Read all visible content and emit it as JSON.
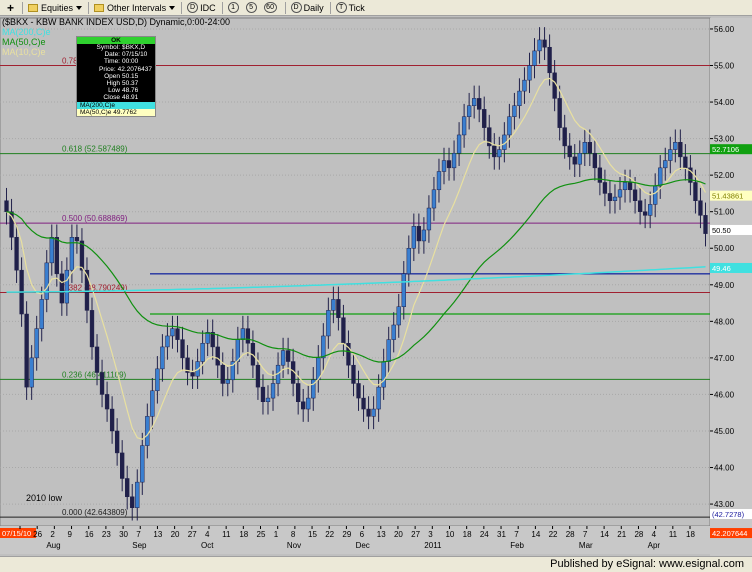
{
  "toolbar": {
    "symbol": "($BKX",
    "group": "Equities",
    "intervals": "Other Intervals",
    "buttons": [
      {
        "glyph": "D",
        "label": "IDC"
      },
      {
        "glyph": "1",
        "label": "1"
      },
      {
        "glyph": "5",
        "label": "5"
      },
      {
        "glyph": "60",
        "label": "60"
      },
      {
        "glyph": "D",
        "label": "Daily"
      },
      {
        "glyph": "T",
        "label": "Tick"
      }
    ]
  },
  "chart": {
    "title": "($BKX - KBW BANK INDEX USD,D) Dynamic,0:00-24:00",
    "legend": {
      "ma50": "MA(50,C)e",
      "ma10": "MA(10,C)e"
    },
    "low_note": "2010 low"
  },
  "data_window": {
    "header": "OK",
    "rows": [
      {
        "k": "Symbol:",
        "v": "$BKX,D"
      },
      {
        "k": "Date:",
        "v": "07/15/10"
      },
      {
        "k": "Time:",
        "v": "00:00"
      },
      {
        "k": "Price:",
        "v": "42.2076437"
      },
      {
        "k": "Open",
        "v": "50.15"
      },
      {
        "k": "High",
        "v": "50.37"
      },
      {
        "k": "Low",
        "v": "48.76"
      },
      {
        "k": "Close",
        "v": "48.91"
      }
    ],
    "ma1": "MA(200,C)e",
    "ma2": "MA(50,C)e 49.7762"
  },
  "chart_data": {
    "type": "candlestick",
    "title": "($BKX - KBW BANK INDEX USD,D) Dynamic,0:00-24:00",
    "ylim": [
      42.4,
      56.3
    ],
    "y_ticks": [
      "56.00",
      "55.00",
      "54.00",
      "53.00",
      "52.00",
      "51.00",
      "50.00",
      "49.00",
      "48.00",
      "47.00",
      "46.00",
      "45.00",
      "44.00",
      "43.00"
    ],
    "x_tick_labels": [
      "19",
      "26",
      "2",
      "9",
      "16",
      "23",
      "30",
      "7",
      "13",
      "20",
      "27",
      "4",
      "11",
      "18",
      "25",
      "1",
      "8",
      "15",
      "22",
      "29",
      "6",
      "13",
      "20",
      "27",
      "3",
      "10",
      "18",
      "24",
      "31",
      "7",
      "14",
      "22",
      "28",
      "7",
      "14",
      "21",
      "28",
      "4",
      "11",
      "18"
    ],
    "month_labels": [
      "Aug",
      "Sep",
      "Oct",
      "Nov",
      "Dec",
      "2011",
      "Feb",
      "Mar",
      "Apr"
    ],
    "start_date_label": "07/15/10",
    "close": [
      51.0,
      50.3,
      49.4,
      48.2,
      46.2,
      47.0,
      47.8,
      48.6,
      49.6,
      50.3,
      49.3,
      48.5,
      49.4,
      50.3,
      50.2,
      49.4,
      48.3,
      47.3,
      46.6,
      46.0,
      45.6,
      45.0,
      44.4,
      43.7,
      43.2,
      42.9,
      43.6,
      44.6,
      45.4,
      46.1,
      46.7,
      47.3,
      47.6,
      47.8,
      47.5,
      47.0,
      46.6,
      46.5,
      46.9,
      47.4,
      47.7,
      47.3,
      46.8,
      46.3,
      46.4,
      46.9,
      47.5,
      47.8,
      47.4,
      46.8,
      46.2,
      45.8,
      45.9,
      46.3,
      46.8,
      47.2,
      46.9,
      46.3,
      45.8,
      45.6,
      45.9,
      46.4,
      47.0,
      47.6,
      48.3,
      48.6,
      48.1,
      47.4,
      46.8,
      46.3,
      45.9,
      45.6,
      45.4,
      45.6,
      46.2,
      46.9,
      47.5,
      47.9,
      48.4,
      49.3,
      50.0,
      50.6,
      50.2,
      50.5,
      51.1,
      51.6,
      52.1,
      52.4,
      52.2,
      52.6,
      53.1,
      53.6,
      53.9,
      54.1,
      53.8,
      53.3,
      52.8,
      52.5,
      52.7,
      53.1,
      53.6,
      53.9,
      54.3,
      54.6,
      55.0,
      55.4,
      55.7,
      55.5,
      54.8,
      54.1,
      53.3,
      52.8,
      52.5,
      52.3,
      52.6,
      52.9,
      52.6,
      52.2,
      51.8,
      51.5,
      51.3,
      51.4,
      51.6,
      51.8,
      51.6,
      51.3,
      51.0,
      50.9,
      51.2,
      51.7,
      52.2,
      52.4,
      52.7,
      52.9,
      52.5,
      52.2,
      51.8,
      51.3,
      50.9,
      50.4
    ],
    "levels": [
      {
        "label": "0.78",
        "value": 55.0,
        "color": "#a02030"
      },
      {
        "label": "0.618 (52.587489)",
        "value": 52.587489,
        "color": "#208020"
      },
      {
        "label": "0.500 (50.688869)",
        "value": 50.688869,
        "color": "#802080"
      },
      {
        "label": "0.382 (48.790249)",
        "value": 48.790249,
        "color": "#a02030"
      },
      {
        "label": "0.236 (46.411109)",
        "value": 46.411109,
        "color": "#208020"
      },
      {
        "label": "0.000 (42.643809)",
        "value": 42.643809,
        "color": "#202020"
      }
    ],
    "extra_lines": [
      {
        "value": 48.2,
        "color": "#10a010"
      },
      {
        "value": 49.3,
        "color": "#2030a0"
      }
    ],
    "price_tags": [
      {
        "value": 52.7106,
        "text": "52.7106",
        "bg": "#10a010",
        "fg": "#ffffff"
      },
      {
        "value": 51.4386,
        "text": "51.43861",
        "bg": "#ffffc0",
        "fg": "#808000"
      },
      {
        "value": 50.5,
        "text": "50.50",
        "bg": "#ffffff",
        "fg": "#000000"
      },
      {
        "value": 49.46,
        "text": "49.46",
        "bg": "#40e0e0",
        "fg": "#ffffff"
      },
      {
        "value": 42.7278,
        "text": "(42.7278)",
        "bg": "#ffffff",
        "fg": "#2020a0"
      },
      {
        "value": 42.2076,
        "text": "42.207644",
        "bg": "#ff4000",
        "fg": "#ffffff"
      }
    ],
    "colors": {
      "bar": "#20204a",
      "up": "#3a7fd0",
      "ma50": "#109010",
      "ma10": "#e8e0a0",
      "ma200": "#40e0e0",
      "bg": "#c0c0c0",
      "grid": "#a8a8a8"
    }
  },
  "status": {
    "text": "Published by eSignal: www.esignal.com"
  }
}
